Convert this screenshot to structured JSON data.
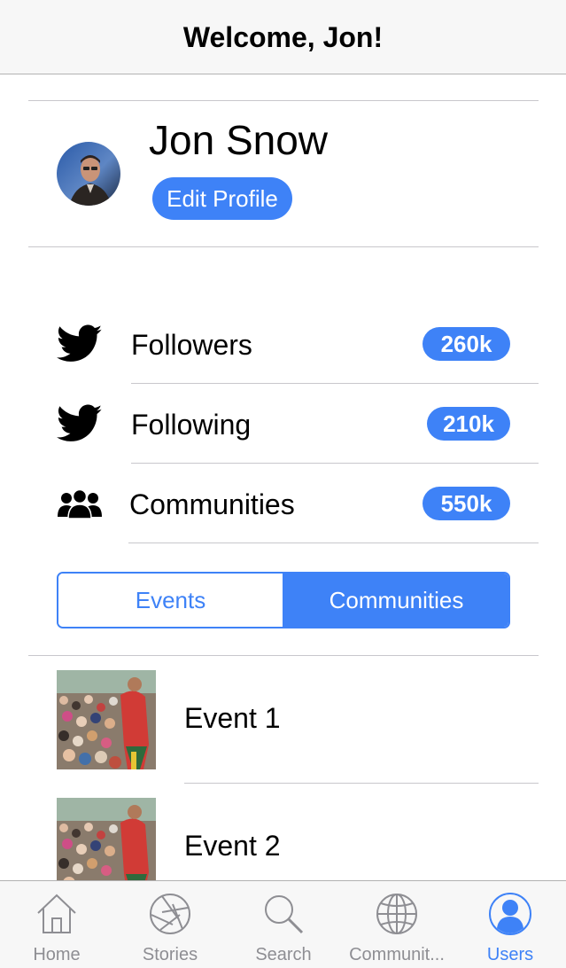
{
  "navbar": {
    "title": "Welcome, Jon!"
  },
  "profile": {
    "name": "Jon Snow",
    "edit_label": "Edit Profile",
    "avatar_icon": "user-photo"
  },
  "stats": [
    {
      "icon": "twitter-bird-icon",
      "label": "Followers",
      "count": "260k"
    },
    {
      "icon": "twitter-bird-icon",
      "label": "Following",
      "count": "210k"
    },
    {
      "icon": "people-group-icon",
      "label": "Communities",
      "count": "550k"
    }
  ],
  "segmented": {
    "items": [
      "Events",
      "Communities"
    ],
    "selected": "Communities"
  },
  "events": [
    {
      "title": "Event 1",
      "thumbnail": "crowd-photo"
    },
    {
      "title": "Event 2",
      "thumbnail": "crowd-photo"
    }
  ],
  "tabbar": {
    "items": [
      {
        "label": "Home",
        "icon": "home-icon",
        "active": false
      },
      {
        "label": "Stories",
        "icon": "aperture-icon",
        "active": false
      },
      {
        "label": "Search",
        "icon": "search-icon",
        "active": false
      },
      {
        "label": "Communit...",
        "icon": "globe-icon",
        "active": false
      },
      {
        "label": "Users",
        "icon": "user-icon",
        "active": true
      }
    ]
  },
  "colors": {
    "accent": "#3e82f7",
    "navbar_bg": "#f7f7f7",
    "separator": "#c8c7cc",
    "inactive_tab": "#8e8e93"
  }
}
